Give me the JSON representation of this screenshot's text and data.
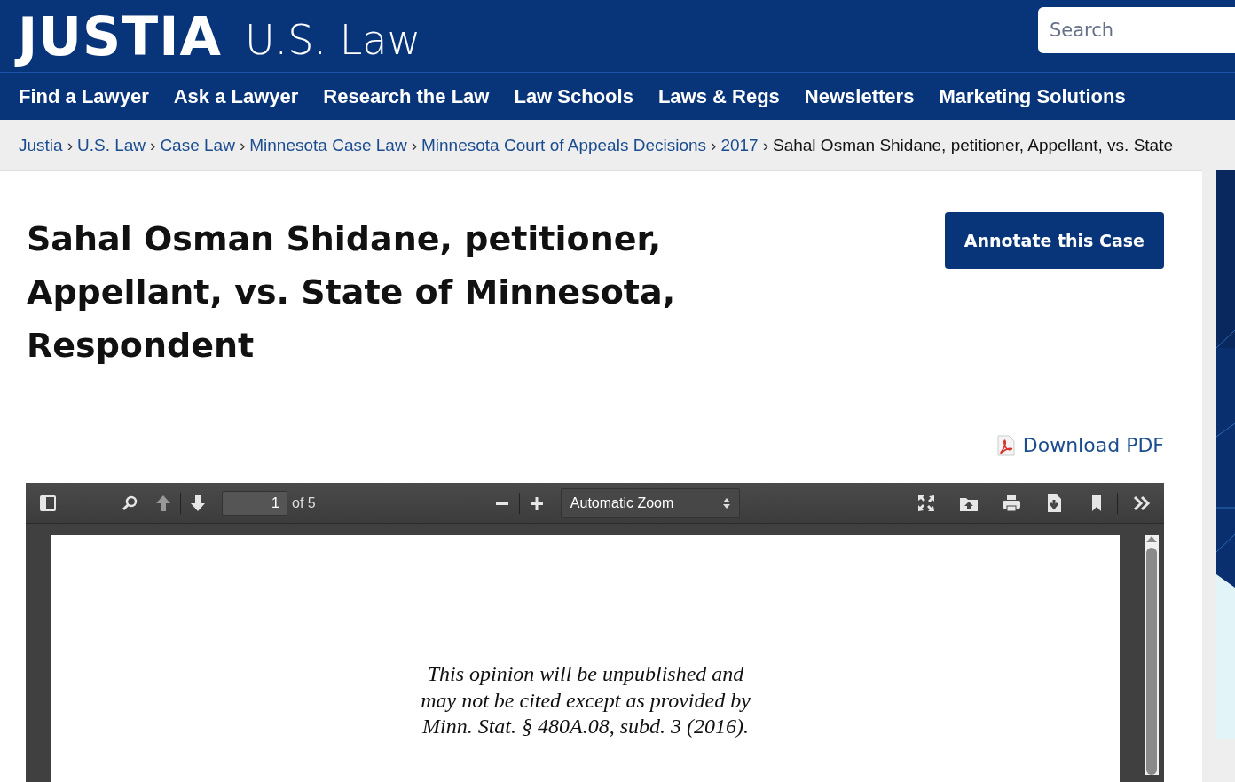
{
  "header": {
    "logo": "JUSTIA",
    "section": "U.S. Law",
    "search": {
      "placeholder": "Search"
    }
  },
  "nav": [
    "Find a Lawyer",
    "Ask a Lawyer",
    "Research the Law",
    "Law Schools",
    "Laws & Regs",
    "Newsletters",
    "Marketing Solutions"
  ],
  "breadcrumb": {
    "links": [
      "Justia",
      "U.S. Law",
      "Case Law",
      "Minnesota Case Law",
      "Minnesota Court of Appeals Decisions",
      "2017"
    ],
    "separator": "›",
    "current": "Sahal Osman Shidane, petitioner, Appellant, vs. State"
  },
  "case": {
    "title": "Sahal Osman Shidane, petitioner, Appellant, vs. State of Minnesota, Respondent",
    "annotate_button": "Annotate this Case",
    "download_link": "Download PDF"
  },
  "pdf_viewer": {
    "page_number": "1",
    "page_count": "of 5",
    "zoom": "Automatic Zoom",
    "page_text": [
      "This opinion will be unpublished and",
      "may not be cited except as provided by",
      "Minn. Stat. § 480A.08, subd. 3 (2016)."
    ]
  }
}
